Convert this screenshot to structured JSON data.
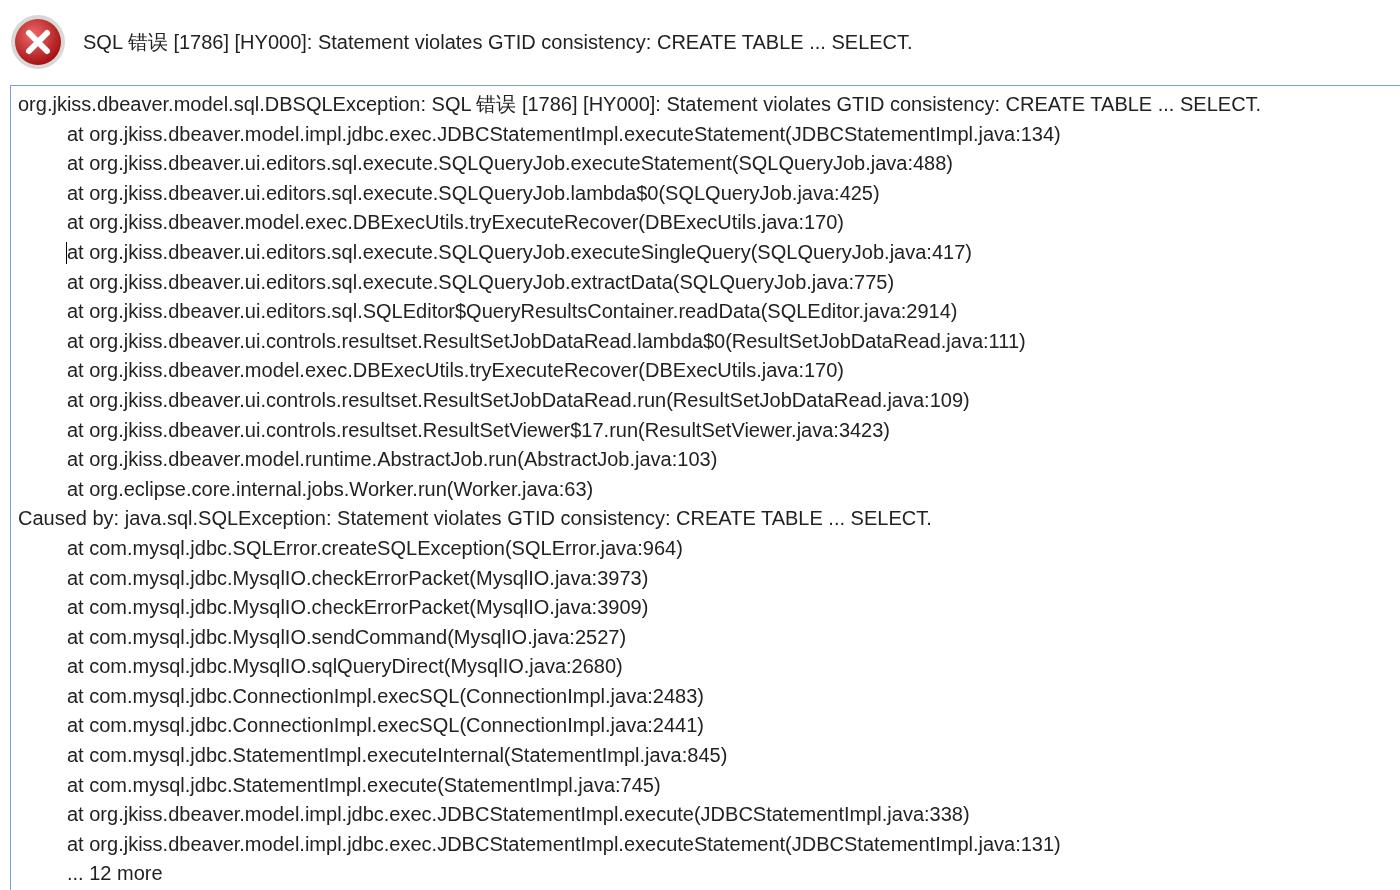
{
  "message": "SQL 错误 [1786] [HY000]: Statement violates GTID consistency: CREATE TABLE ... SELECT.",
  "details": {
    "lines": [
      {
        "kind": "exception",
        "text": "org.jkiss.dbeaver.model.sql.DBSQLException: SQL 错误 [1786] [HY000]: Statement violates GTID consistency: CREATE TABLE ... SELECT."
      },
      {
        "kind": "frame",
        "text": "at org.jkiss.dbeaver.model.impl.jdbc.exec.JDBCStatementImpl.executeStatement(JDBCStatementImpl.java:134)"
      },
      {
        "kind": "frame",
        "text": "at org.jkiss.dbeaver.ui.editors.sql.execute.SQLQueryJob.executeStatement(SQLQueryJob.java:488)"
      },
      {
        "kind": "frame",
        "text": "at org.jkiss.dbeaver.ui.editors.sql.execute.SQLQueryJob.lambda$0(SQLQueryJob.java:425)"
      },
      {
        "kind": "frame",
        "text": "at org.jkiss.dbeaver.model.exec.DBExecUtils.tryExecuteRecover(DBExecUtils.java:170)"
      },
      {
        "kind": "frame",
        "text": "at org.jkiss.dbeaver.ui.editors.sql.execute.SQLQueryJob.executeSingleQuery(SQLQueryJob.java:417)",
        "caret": true
      },
      {
        "kind": "frame",
        "text": "at org.jkiss.dbeaver.ui.editors.sql.execute.SQLQueryJob.extractData(SQLQueryJob.java:775)"
      },
      {
        "kind": "frame",
        "text": "at org.jkiss.dbeaver.ui.editors.sql.SQLEditor$QueryResultsContainer.readData(SQLEditor.java:2914)"
      },
      {
        "kind": "frame",
        "text": "at org.jkiss.dbeaver.ui.controls.resultset.ResultSetJobDataRead.lambda$0(ResultSetJobDataRead.java:111)"
      },
      {
        "kind": "frame",
        "text": "at org.jkiss.dbeaver.model.exec.DBExecUtils.tryExecuteRecover(DBExecUtils.java:170)"
      },
      {
        "kind": "frame",
        "text": "at org.jkiss.dbeaver.ui.controls.resultset.ResultSetJobDataRead.run(ResultSetJobDataRead.java:109)"
      },
      {
        "kind": "frame",
        "text": "at org.jkiss.dbeaver.ui.controls.resultset.ResultSetViewer$17.run(ResultSetViewer.java:3423)"
      },
      {
        "kind": "frame",
        "text": "at org.jkiss.dbeaver.model.runtime.AbstractJob.run(AbstractJob.java:103)"
      },
      {
        "kind": "frame",
        "text": "at org.eclipse.core.internal.jobs.Worker.run(Worker.java:63)"
      },
      {
        "kind": "exception",
        "text": "Caused by: java.sql.SQLException: Statement violates GTID consistency: CREATE TABLE ... SELECT."
      },
      {
        "kind": "frame",
        "text": "at com.mysql.jdbc.SQLError.createSQLException(SQLError.java:964)"
      },
      {
        "kind": "frame",
        "text": "at com.mysql.jdbc.MysqlIO.checkErrorPacket(MysqlIO.java:3973)"
      },
      {
        "kind": "frame",
        "text": "at com.mysql.jdbc.MysqlIO.checkErrorPacket(MysqlIO.java:3909)"
      },
      {
        "kind": "frame",
        "text": "at com.mysql.jdbc.MysqlIO.sendCommand(MysqlIO.java:2527)"
      },
      {
        "kind": "frame",
        "text": "at com.mysql.jdbc.MysqlIO.sqlQueryDirect(MysqlIO.java:2680)"
      },
      {
        "kind": "frame",
        "text": "at com.mysql.jdbc.ConnectionImpl.execSQL(ConnectionImpl.java:2483)"
      },
      {
        "kind": "frame",
        "text": "at com.mysql.jdbc.ConnectionImpl.execSQL(ConnectionImpl.java:2441)"
      },
      {
        "kind": "frame",
        "text": "at com.mysql.jdbc.StatementImpl.executeInternal(StatementImpl.java:845)"
      },
      {
        "kind": "frame",
        "text": "at com.mysql.jdbc.StatementImpl.execute(StatementImpl.java:745)"
      },
      {
        "kind": "frame",
        "text": "at org.jkiss.dbeaver.model.impl.jdbc.exec.JDBCStatementImpl.execute(JDBCStatementImpl.java:338)"
      },
      {
        "kind": "frame",
        "text": "at org.jkiss.dbeaver.model.impl.jdbc.exec.JDBCStatementImpl.executeStatement(JDBCStatementImpl.java:131)"
      },
      {
        "kind": "frame",
        "text": "... 12 more"
      }
    ]
  }
}
